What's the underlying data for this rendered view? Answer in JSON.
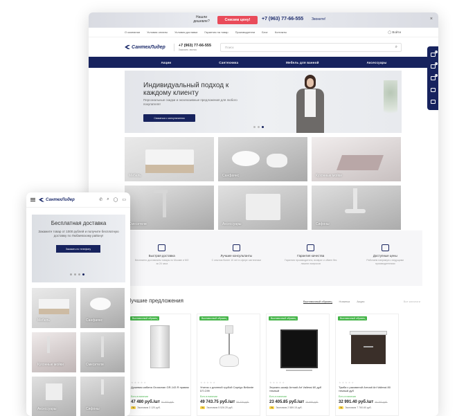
{
  "desktop": {
    "promo": {
      "question": "Нашли дешевле?",
      "button": "Снизим цену!",
      "phone": "+7 (963) 77-66-555",
      "call": "Звоните!",
      "close": "×"
    },
    "topnav": {
      "items": [
        "О компании",
        "Условия оплаты",
        "Условия доставки",
        "Гарантия на товар",
        "Производители",
        "Блог",
        "Контакты"
      ],
      "login": "Войти"
    },
    "header": {
      "logo": "СантехЛидер",
      "phone": "+7 (963) 77-66-555",
      "phone_sub": "Заказать звонок",
      "search_placeholder": "Поиск"
    },
    "catbar": [
      "Акции",
      "Сантехника",
      "Мебель для ванной",
      "Аксессуары"
    ],
    "hero": {
      "title": "Индивидуальный подход к каждому клиенту",
      "subtitle": "Персональные скидки и эксклюзивные предложения для любого покупателя!",
      "cta": "Связаться с консультантом"
    },
    "categories": [
      {
        "label": "Мебель"
      },
      {
        "label": "Санфаянс"
      },
      {
        "label": "Кухонные мойки"
      },
      {
        "label": "Смесители"
      },
      {
        "label": "Аксессуары"
      },
      {
        "label": "Сифоны"
      }
    ],
    "features": [
      {
        "title": "Быстрая доставка",
        "desc": "Бесплатно доставляем товары по Москве и МО за 24 часа"
      },
      {
        "title": "Лучшие консультанты",
        "desc": "С опытом более 10 лет в сфере сантехники"
      },
      {
        "title": "Гарантия качества",
        "desc": "Гарантия производителя, возврат и обмен без лишних вопросов"
      },
      {
        "title": "Доступные цены",
        "desc": "Работаем напрямую с ведущими производителями"
      }
    ],
    "best": {
      "title": "Лучшие предложения",
      "tabs": [
        "Выставочный образец",
        "Новинка",
        "Акция"
      ],
      "all": "Все каталоги"
    },
    "products": [
      {
        "badge": "Выставочный образец",
        "name": "Душевая кабина Grossman GR-143 R правая",
        "avail": "Есть в наличии",
        "price": "47 480 руб./шт",
        "old": "51 600 руб.",
        "econ": "Экономия 3 120 руб."
      },
      {
        "badge": "Выставочный образец",
        "name": "Унитаз с длинной трубой Caprigo Bellante DT-C99",
        "avail": "Есть в наличии",
        "price": "49 743.75 руб./шт",
        "old": "55 270 руб.",
        "econ": "Экономия 5 526.25 руб."
      },
      {
        "badge": "Выставочный образец",
        "name": "Зеркало-шкаф Armadi Art Vallessi 80 дуб темный",
        "avail": "Есть в наличии",
        "price": "23 405.85 руб./шт",
        "old": "25 995 руб.",
        "econ": "Экономия 2 589.15 руб."
      },
      {
        "badge": "Выставочный образец",
        "name": "Тумба с раковиной Armadi Art Vallessi 80 темный дуб",
        "avail": "Есть в наличии",
        "price": "32 991.40 руб./шт",
        "old": "40 752 руб.",
        "econ": "Экономия 7 760.60 руб."
      }
    ],
    "sticky_counts": [
      "0",
      "0",
      "0"
    ]
  },
  "mobile": {
    "logo": "СантехЛидер",
    "hero": {
      "title": "Бесплатная доставка",
      "subtitle": "Закажите товар от 1000 рублей и получите бесплатную доставку по Любаевскому району!",
      "cta": "Заказать по телефону"
    },
    "categories": [
      {
        "label": "Мебель"
      },
      {
        "label": "Санфаянс"
      },
      {
        "label": "Кухонные мойки"
      },
      {
        "label": "Смесители"
      },
      {
        "label": "Аксессуары"
      },
      {
        "label": "Сифоны"
      }
    ]
  },
  "colors": {
    "brand": "#17235e",
    "accent": "#e94b5a",
    "badge": "#45b549"
  }
}
